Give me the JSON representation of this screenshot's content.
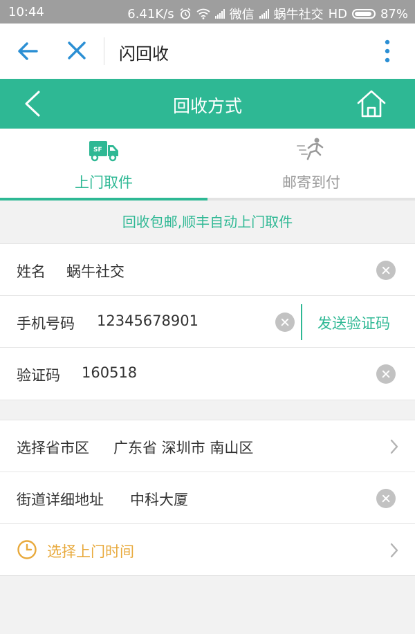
{
  "status_bar": {
    "time": "10:44",
    "speed": "6.41K/s",
    "carrier1": "微信",
    "carrier2": "蜗牛社交",
    "network": "HD",
    "battery": "87%"
  },
  "browser": {
    "title": "闪回收"
  },
  "nav": {
    "title": "回收方式"
  },
  "tabs": [
    {
      "label": "上门取件",
      "icon": "truck-sf-icon",
      "active": true
    },
    {
      "label": "邮寄到付",
      "icon": "running-man-icon",
      "active": false
    }
  ],
  "notice": "回收包邮,顺丰自动上门取件",
  "form": {
    "name_label": "姓名",
    "name_value": "蜗牛社交",
    "phone_label": "手机号码",
    "phone_value": "12345678901",
    "send_code": "发送验证码",
    "code_label": "验证码",
    "code_value": "160518"
  },
  "address": {
    "region_label": "选择省市区",
    "region_value": "广东省 深圳市 南山区",
    "street_label": "街道详细地址",
    "street_value": "中科大厦",
    "time_label": "选择上门时间"
  },
  "colors": {
    "accent": "#2eb894",
    "time_accent": "#e8a93b",
    "status_bar": "#9e9e9e"
  }
}
